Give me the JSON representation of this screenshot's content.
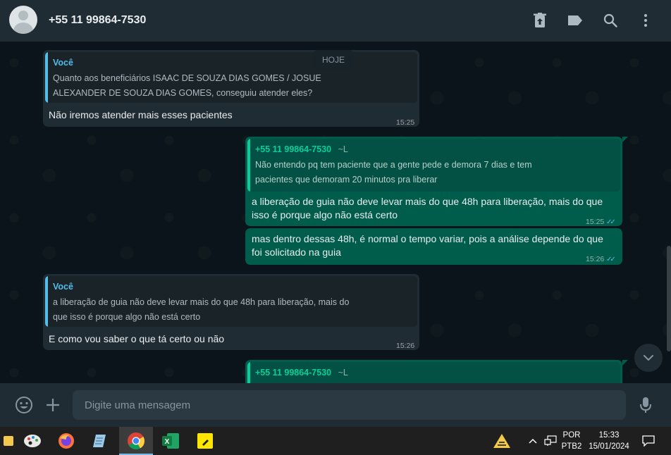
{
  "header": {
    "contact_name": "+55 11 99864-7530",
    "icons": [
      "delete-icon",
      "label-icon",
      "search-icon",
      "menu-icon"
    ]
  },
  "chat": {
    "date_chip": "HOJE",
    "messages": [
      {
        "direction": "incoming",
        "quote_author": "Você",
        "quote_lines": [
          "Quanto aos beneficiários ISAAC DE SOUZA DIAS GOMES / JOSUE",
          "ALEXANDER DE SOUZA DIAS GOMES, conseguiu atender eles?"
        ],
        "text_lines": [
          "Não iremos atender mais esses pacientes"
        ],
        "time": "15:25"
      },
      {
        "direction": "outgoing",
        "quote_author": "+55 11 99864-7530",
        "quote_author_suffix": "~L",
        "quote_lines": [
          "Não entendo pq tem paciente que a gente pede e demora 7 dias e tem",
          "pacientes que demoram 20 minutos pra liberar"
        ],
        "text_lines": [
          "a liberação de guia não deve levar mais do que 48h para liberação, mais do que",
          "isso é porque algo não está certo"
        ],
        "time": "15:25"
      },
      {
        "direction": "outgoing",
        "text_lines": [
          "mas dentro dessas 48h, é normal o tempo variar, pois a análise depende do que",
          "foi solicitado na guia"
        ],
        "time": "15:26"
      },
      {
        "direction": "incoming",
        "quote_author": "Você",
        "quote_lines": [
          "a liberação de guia não deve levar mais do que 48h para liberação, mais do",
          "que isso é porque algo não está certo"
        ],
        "text_lines": [
          "E como vou saber o que tá certo ou não"
        ],
        "time": "15:26"
      },
      {
        "direction": "outgoing",
        "quote_author": "+55 11 99864-7530",
        "quote_author_suffix": "~L",
        "partial": true
      }
    ]
  },
  "composer": {
    "placeholder": "Digite uma mensagem"
  },
  "taskbar": {
    "apps": [
      "app-icon",
      "paint-icon",
      "firefox-icon",
      "notepad-icon",
      "chrome-icon",
      "excel-icon",
      "sticky-notes-icon"
    ],
    "active_app": "chrome-icon",
    "language_top": "POR",
    "language_bottom": "PTB2",
    "clock_time": "15:33",
    "clock_date": "15/01/2024"
  },
  "colors": {
    "incoming_bubble": "#202c33",
    "outgoing_bubble": "#005c4b",
    "accent_green": "#06cf9c",
    "you_author": "#53bdeb",
    "read_ticks": "#53bdeb"
  }
}
